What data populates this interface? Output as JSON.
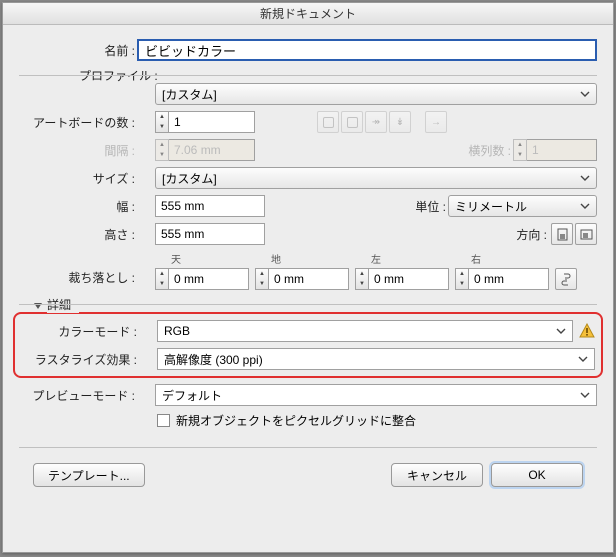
{
  "title": "新規ドキュメント",
  "name": {
    "label": "名前 :",
    "value": "ビビッドカラー"
  },
  "profile": {
    "label": "プロファイル :",
    "value": "[カスタム]"
  },
  "artboards": {
    "label": "アートボードの数 :",
    "value": "1"
  },
  "spacing": {
    "label": "間隔 :",
    "value": "7.06 mm"
  },
  "cols": {
    "label": "横列数 :",
    "value": "1"
  },
  "size": {
    "label": "サイズ :",
    "value": "[カスタム]"
  },
  "width": {
    "label": "幅 :",
    "value": "555 mm"
  },
  "height": {
    "label": "高さ :",
    "value": "555 mm"
  },
  "unit": {
    "label": "単位 :",
    "value": "ミリメートル"
  },
  "orient": {
    "label": "方向 :"
  },
  "bleed": {
    "label": "裁ち落とし :",
    "top": {
      "label": "天",
      "value": "0 mm"
    },
    "bottom": {
      "label": "地",
      "value": "0 mm"
    },
    "left": {
      "label": "左",
      "value": "0 mm"
    },
    "right": {
      "label": "右",
      "value": "0 mm"
    }
  },
  "advanced": "詳細",
  "colormode": {
    "label": "カラーモード :",
    "value": "RGB"
  },
  "raster": {
    "label": "ラスタライズ効果 :",
    "value": "高解像度 (300 ppi)"
  },
  "preview": {
    "label": "プレビューモード :",
    "value": "デフォルト"
  },
  "pixelgrid": "新規オブジェクトをピクセルグリッドに整合",
  "buttons": {
    "template": "テンプレート...",
    "cancel": "キャンセル",
    "ok": "OK"
  }
}
